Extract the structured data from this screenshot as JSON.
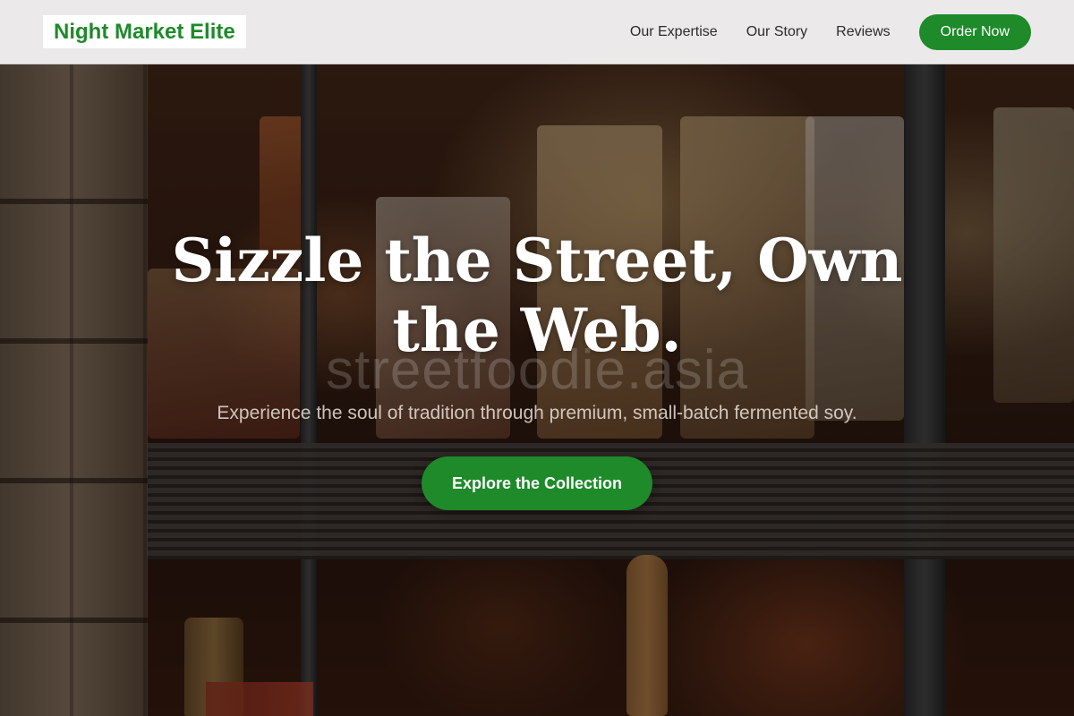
{
  "header": {
    "brand": "Night Market Elite",
    "nav": [
      "Our Expertise",
      "Our Story",
      "Reviews"
    ],
    "cta_label": "Order Now"
  },
  "hero": {
    "title": "Sizzle the Street, Own the Web.",
    "watermark": "streetfoodie.asia",
    "subtitle": "Experience the soul of tradition through premium, small-batch fermented soy.",
    "cta_label": "Explore the Collection"
  },
  "colors": {
    "accent": "#1e8a2a",
    "header_bg": "#fafafa",
    "text_on_hero": "#ffffff"
  }
}
